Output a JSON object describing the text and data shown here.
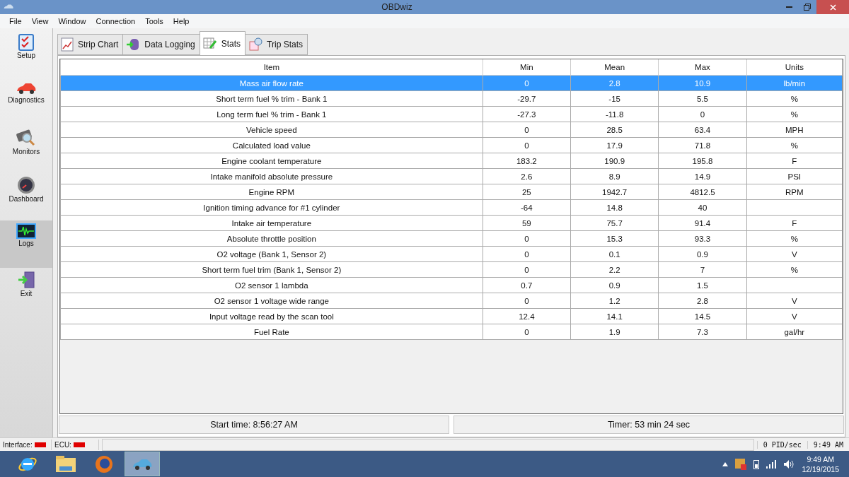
{
  "window": {
    "title": "OBDwiz"
  },
  "menu": [
    "File",
    "View",
    "Window",
    "Connection",
    "Tools",
    "Help"
  ],
  "sidebar": [
    {
      "label": "Setup",
      "kind": "setup",
      "selected": false
    },
    {
      "label": "Diagnostics",
      "kind": "diagnostics",
      "selected": false
    },
    {
      "label": "Monitors",
      "kind": "monitors",
      "selected": false
    },
    {
      "label": "Dashboard",
      "kind": "dashboard",
      "selected": false
    },
    {
      "label": "Logs",
      "kind": "logs",
      "selected": true
    },
    {
      "label": "Exit",
      "kind": "exit",
      "selected": false
    }
  ],
  "tabs": [
    {
      "label": "Strip Chart",
      "kind": "chart",
      "selected": false
    },
    {
      "label": "Data Logging",
      "kind": "database",
      "selected": false
    },
    {
      "label": "Stats",
      "kind": "stats",
      "selected": true
    },
    {
      "label": "Trip Stats",
      "kind": "trip",
      "selected": false
    }
  ],
  "table": {
    "columns": [
      "Item",
      "Min",
      "Mean",
      "Max",
      "Units"
    ],
    "rows": [
      {
        "cells": [
          "Mass air flow rate",
          "0",
          "2.8",
          "10.9",
          "lb/min"
        ],
        "selected": true
      },
      {
        "cells": [
          "Short term fuel % trim - Bank 1",
          "-29.7",
          "-15",
          "5.5",
          "%"
        ],
        "selected": false
      },
      {
        "cells": [
          "Long term fuel % trim - Bank 1",
          "-27.3",
          "-11.8",
          "0",
          "%"
        ],
        "selected": false
      },
      {
        "cells": [
          "Vehicle speed",
          "0",
          "28.5",
          "63.4",
          "MPH"
        ],
        "selected": false
      },
      {
        "cells": [
          "Calculated load value",
          "0",
          "17.9",
          "71.8",
          "%"
        ],
        "selected": false
      },
      {
        "cells": [
          "Engine coolant temperature",
          "183.2",
          "190.9",
          "195.8",
          "F"
        ],
        "selected": false
      },
      {
        "cells": [
          "Intake manifold absolute pressure",
          "2.6",
          "8.9",
          "14.9",
          "PSI"
        ],
        "selected": false
      },
      {
        "cells": [
          "Engine RPM",
          "25",
          "1942.7",
          "4812.5",
          "RPM"
        ],
        "selected": false
      },
      {
        "cells": [
          "Ignition timing advance for #1 cylinder",
          "-64",
          "14.8",
          "40",
          ""
        ],
        "selected": false
      },
      {
        "cells": [
          "Intake air temperature",
          "59",
          "75.7",
          "91.4",
          "F"
        ],
        "selected": false
      },
      {
        "cells": [
          "Absolute throttle position",
          "0",
          "15.3",
          "93.3",
          "%"
        ],
        "selected": false
      },
      {
        "cells": [
          "O2 voltage (Bank 1, Sensor 2)",
          "0",
          "0.1",
          "0.9",
          "V"
        ],
        "selected": false
      },
      {
        "cells": [
          "Short term fuel trim (Bank 1, Sensor 2)",
          "0",
          "2.2",
          "7",
          "%"
        ],
        "selected": false
      },
      {
        "cells": [
          "O2 sensor 1 lambda",
          "0.7",
          "0.9",
          "1.5",
          ""
        ],
        "selected": false
      },
      {
        "cells": [
          "O2 sensor 1 voltage wide range",
          "0",
          "1.2",
          "2.8",
          "V"
        ],
        "selected": false
      },
      {
        "cells": [
          "Input voltage read by the scan tool",
          "12.4",
          "14.1",
          "14.5",
          "V"
        ],
        "selected": false
      },
      {
        "cells": [
          "Fuel Rate",
          "0",
          "1.9",
          "7.3",
          "gal/hr"
        ],
        "selected": false
      }
    ]
  },
  "footer": {
    "start_time": "Start time: 8:56:27 AM",
    "timer": "Timer: 53 min 24 sec"
  },
  "status_bar": {
    "indicators": [
      {
        "label": "Interface:",
        "color": "#e00000"
      },
      {
        "label": "ECU:",
        "color": "#e00000"
      }
    ],
    "rate": "0 PID/sec",
    "time": "9:49 AM"
  },
  "taskbar": {
    "apps": [
      {
        "kind": "browser-e",
        "selected": false
      },
      {
        "kind": "folder",
        "selected": false
      },
      {
        "kind": "browser-fox",
        "selected": false
      },
      {
        "kind": "car",
        "selected": true
      }
    ],
    "clock_time": "9:49 AM",
    "clock_date": "12/19/2015"
  }
}
